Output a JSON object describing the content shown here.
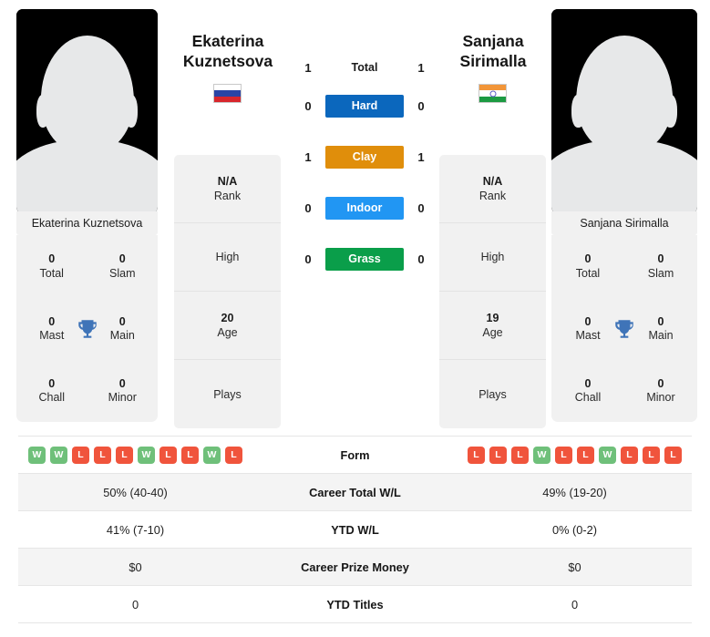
{
  "players": {
    "left": {
      "first_name": "Ekaterina",
      "last_name": "Kuznetsova",
      "full_name": "Ekaterina Kuznetsova",
      "flag": "russia-flag",
      "avatar": "player-avatar-placeholder",
      "rank_value": "N/A",
      "rank_label": "Rank",
      "high_value": "",
      "high_label": "High",
      "age_value": "20",
      "age_label": "Age",
      "plays_value": "",
      "plays_label": "Plays",
      "titles": [
        {
          "value": "0",
          "label": "Total"
        },
        {
          "value": "0",
          "label": "Slam"
        },
        {
          "value": "0",
          "label": "Mast"
        },
        {
          "value": "0",
          "label": "Main"
        },
        {
          "value": "0",
          "label": "Chall"
        },
        {
          "value": "0",
          "label": "Minor"
        }
      ],
      "form": [
        "W",
        "W",
        "L",
        "L",
        "L",
        "W",
        "L",
        "L",
        "W",
        "L"
      ],
      "career_total_wl": "50% (40-40)",
      "ytd_wl": "41% (7-10)",
      "career_prize_money": "$0",
      "ytd_titles": "0"
    },
    "right": {
      "first_name": "Sanjana",
      "last_name": "Sirimalla",
      "full_name": "Sanjana Sirimalla",
      "flag": "india-flag",
      "avatar": "player-avatar-placeholder",
      "rank_value": "N/A",
      "rank_label": "Rank",
      "high_value": "",
      "high_label": "High",
      "age_value": "19",
      "age_label": "Age",
      "plays_value": "",
      "plays_label": "Plays",
      "titles": [
        {
          "value": "0",
          "label": "Total"
        },
        {
          "value": "0",
          "label": "Slam"
        },
        {
          "value": "0",
          "label": "Mast"
        },
        {
          "value": "0",
          "label": "Main"
        },
        {
          "value": "0",
          "label": "Chall"
        },
        {
          "value": "0",
          "label": "Minor"
        }
      ],
      "form": [
        "L",
        "L",
        "L",
        "W",
        "L",
        "L",
        "W",
        "L",
        "L",
        "L"
      ],
      "career_total_wl": "49% (19-20)",
      "ytd_wl": "0% (0-2)",
      "career_prize_money": "$0",
      "ytd_titles": "0"
    }
  },
  "head_to_head": {
    "total": {
      "label": "Total",
      "left_score": "1",
      "right_score": "1"
    },
    "surfaces": [
      {
        "label": "Hard",
        "left_score": "0",
        "right_score": "0",
        "color": "#0b67bd"
      },
      {
        "label": "Clay",
        "left_score": "1",
        "right_score": "1",
        "color": "#e08e0b"
      },
      {
        "label": "Indoor",
        "left_score": "0",
        "right_score": "0",
        "color": "#2196f3"
      },
      {
        "label": "Grass",
        "left_score": "0",
        "right_score": "0",
        "color": "#0a9e4a"
      }
    ]
  },
  "stats_table": {
    "rows": [
      {
        "label": "Form",
        "type": "form"
      },
      {
        "label": "Career Total W/L",
        "type": "text",
        "left": "50% (40-40)",
        "right": "49% (19-20)"
      },
      {
        "label": "YTD W/L",
        "type": "text",
        "left": "41% (7-10)",
        "right": "0% (0-2)"
      },
      {
        "label": "Career Prize Money",
        "type": "text",
        "left": "$0",
        "right": "$0"
      },
      {
        "label": "YTD Titles",
        "type": "text",
        "left": "0",
        "right": "0"
      }
    ]
  },
  "colors": {
    "hard": "#0b67bd",
    "clay": "#e08e0b",
    "indoor": "#2196f3",
    "grass": "#0a9e4a",
    "win": "#6fc07a",
    "loss": "#f0543c",
    "trophy": "#3f74b8",
    "card_bg": "#f1f1f1"
  }
}
